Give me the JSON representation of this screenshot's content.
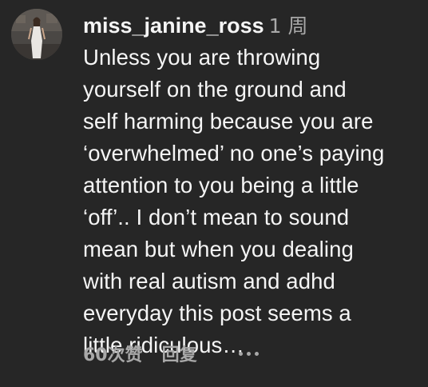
{
  "comment": {
    "username": "miss_janine_ross",
    "time": "1 周",
    "text": "Unless you are throwing\nyourself on the ground and\nself harming because you are\n‘overwhelmed’ no one’s paying\nattention to you being a little\n‘off’.. I don’t mean to sound\nmean but when you dealing\nwith real autism and adhd\neveryday this post seems a\nlittle ridiculous…",
    "likes_label": "60次赞",
    "reply_label": "回复",
    "more_icon": "more-horizontal-icon",
    "avatar_icon": "profile-avatar"
  },
  "colors": {
    "background": "#262626",
    "primary_text": "#f5f5f5",
    "secondary_text": "#a8a8a8"
  }
}
